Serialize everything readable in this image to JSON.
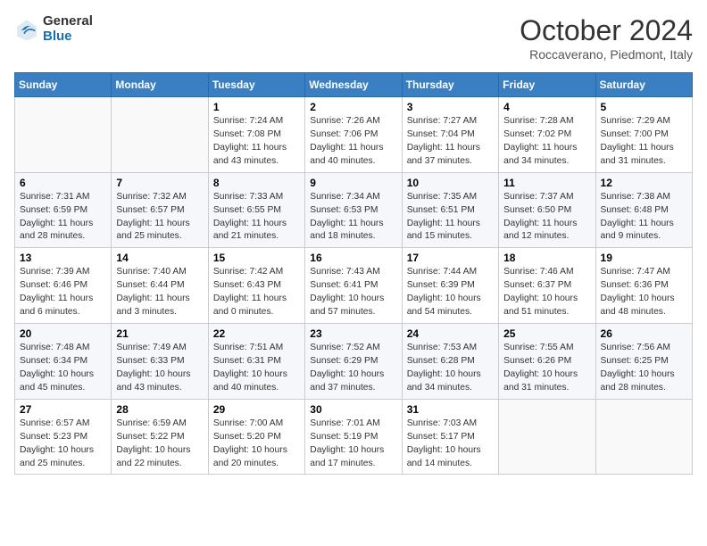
{
  "header": {
    "logo_general": "General",
    "logo_blue": "Blue",
    "month_title": "October 2024",
    "location": "Roccaverano, Piedmont, Italy"
  },
  "days_of_week": [
    "Sunday",
    "Monday",
    "Tuesday",
    "Wednesday",
    "Thursday",
    "Friday",
    "Saturday"
  ],
  "weeks": [
    [
      {
        "day": "",
        "info": ""
      },
      {
        "day": "",
        "info": ""
      },
      {
        "day": "1",
        "info": "Sunrise: 7:24 AM\nSunset: 7:08 PM\nDaylight: 11 hours and 43 minutes."
      },
      {
        "day": "2",
        "info": "Sunrise: 7:26 AM\nSunset: 7:06 PM\nDaylight: 11 hours and 40 minutes."
      },
      {
        "day": "3",
        "info": "Sunrise: 7:27 AM\nSunset: 7:04 PM\nDaylight: 11 hours and 37 minutes."
      },
      {
        "day": "4",
        "info": "Sunrise: 7:28 AM\nSunset: 7:02 PM\nDaylight: 11 hours and 34 minutes."
      },
      {
        "day": "5",
        "info": "Sunrise: 7:29 AM\nSunset: 7:00 PM\nDaylight: 11 hours and 31 minutes."
      }
    ],
    [
      {
        "day": "6",
        "info": "Sunrise: 7:31 AM\nSunset: 6:59 PM\nDaylight: 11 hours and 28 minutes."
      },
      {
        "day": "7",
        "info": "Sunrise: 7:32 AM\nSunset: 6:57 PM\nDaylight: 11 hours and 25 minutes."
      },
      {
        "day": "8",
        "info": "Sunrise: 7:33 AM\nSunset: 6:55 PM\nDaylight: 11 hours and 21 minutes."
      },
      {
        "day": "9",
        "info": "Sunrise: 7:34 AM\nSunset: 6:53 PM\nDaylight: 11 hours and 18 minutes."
      },
      {
        "day": "10",
        "info": "Sunrise: 7:35 AM\nSunset: 6:51 PM\nDaylight: 11 hours and 15 minutes."
      },
      {
        "day": "11",
        "info": "Sunrise: 7:37 AM\nSunset: 6:50 PM\nDaylight: 11 hours and 12 minutes."
      },
      {
        "day": "12",
        "info": "Sunrise: 7:38 AM\nSunset: 6:48 PM\nDaylight: 11 hours and 9 minutes."
      }
    ],
    [
      {
        "day": "13",
        "info": "Sunrise: 7:39 AM\nSunset: 6:46 PM\nDaylight: 11 hours and 6 minutes."
      },
      {
        "day": "14",
        "info": "Sunrise: 7:40 AM\nSunset: 6:44 PM\nDaylight: 11 hours and 3 minutes."
      },
      {
        "day": "15",
        "info": "Sunrise: 7:42 AM\nSunset: 6:43 PM\nDaylight: 11 hours and 0 minutes."
      },
      {
        "day": "16",
        "info": "Sunrise: 7:43 AM\nSunset: 6:41 PM\nDaylight: 10 hours and 57 minutes."
      },
      {
        "day": "17",
        "info": "Sunrise: 7:44 AM\nSunset: 6:39 PM\nDaylight: 10 hours and 54 minutes."
      },
      {
        "day": "18",
        "info": "Sunrise: 7:46 AM\nSunset: 6:37 PM\nDaylight: 10 hours and 51 minutes."
      },
      {
        "day": "19",
        "info": "Sunrise: 7:47 AM\nSunset: 6:36 PM\nDaylight: 10 hours and 48 minutes."
      }
    ],
    [
      {
        "day": "20",
        "info": "Sunrise: 7:48 AM\nSunset: 6:34 PM\nDaylight: 10 hours and 45 minutes."
      },
      {
        "day": "21",
        "info": "Sunrise: 7:49 AM\nSunset: 6:33 PM\nDaylight: 10 hours and 43 minutes."
      },
      {
        "day": "22",
        "info": "Sunrise: 7:51 AM\nSunset: 6:31 PM\nDaylight: 10 hours and 40 minutes."
      },
      {
        "day": "23",
        "info": "Sunrise: 7:52 AM\nSunset: 6:29 PM\nDaylight: 10 hours and 37 minutes."
      },
      {
        "day": "24",
        "info": "Sunrise: 7:53 AM\nSunset: 6:28 PM\nDaylight: 10 hours and 34 minutes."
      },
      {
        "day": "25",
        "info": "Sunrise: 7:55 AM\nSunset: 6:26 PM\nDaylight: 10 hours and 31 minutes."
      },
      {
        "day": "26",
        "info": "Sunrise: 7:56 AM\nSunset: 6:25 PM\nDaylight: 10 hours and 28 minutes."
      }
    ],
    [
      {
        "day": "27",
        "info": "Sunrise: 6:57 AM\nSunset: 5:23 PM\nDaylight: 10 hours and 25 minutes."
      },
      {
        "day": "28",
        "info": "Sunrise: 6:59 AM\nSunset: 5:22 PM\nDaylight: 10 hours and 22 minutes."
      },
      {
        "day": "29",
        "info": "Sunrise: 7:00 AM\nSunset: 5:20 PM\nDaylight: 10 hours and 20 minutes."
      },
      {
        "day": "30",
        "info": "Sunrise: 7:01 AM\nSunset: 5:19 PM\nDaylight: 10 hours and 17 minutes."
      },
      {
        "day": "31",
        "info": "Sunrise: 7:03 AM\nSunset: 5:17 PM\nDaylight: 10 hours and 14 minutes."
      },
      {
        "day": "",
        "info": ""
      },
      {
        "day": "",
        "info": ""
      }
    ]
  ]
}
